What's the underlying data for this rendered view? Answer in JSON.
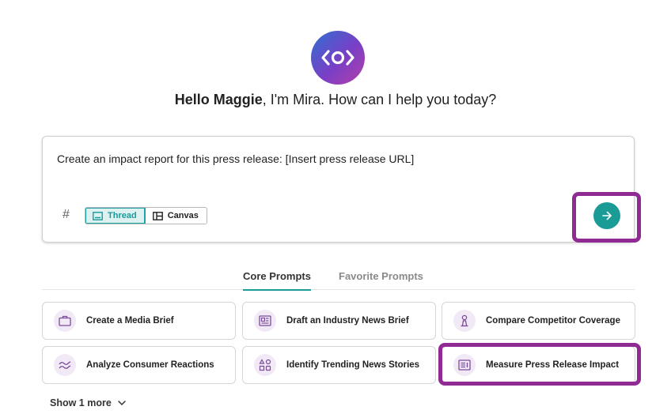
{
  "assistant": {
    "logo_icon": "mira-eye-icon",
    "greeting_name": "Hello Maggie",
    "greeting_rest": ", I'm Mira. How can I help you today?"
  },
  "composer": {
    "text": "Create an impact report for this press release: [Insert press release URL]",
    "hash_symbol": "#",
    "modes": [
      {
        "label": "Thread",
        "icon": "thread-icon",
        "active": true
      },
      {
        "label": "Canvas",
        "icon": "canvas-icon",
        "active": false
      }
    ],
    "send_icon": "arrow-right-icon"
  },
  "tabs": [
    {
      "label": "Core Prompts",
      "active": true
    },
    {
      "label": "Favorite Prompts",
      "active": false
    }
  ],
  "prompts": [
    {
      "label": "Create a Media Brief",
      "icon": "briefcase-icon"
    },
    {
      "label": "Draft an Industry News Brief",
      "icon": "newspaper-icon"
    },
    {
      "label": "Compare Competitor Coverage",
      "icon": "chess-pawn-icon"
    },
    {
      "label": "Analyze Consumer Reactions",
      "icon": "wave-lines-icon"
    },
    {
      "label": "Identify Trending News Stories",
      "icon": "shapes-icon"
    },
    {
      "label": "Measure Press Release Impact",
      "icon": "report-icon"
    }
  ],
  "show_more": {
    "label": "Show 1 more"
  },
  "colors": {
    "accent_teal": "#1b9b96",
    "highlight_purple": "#8f2b93",
    "icon_purple": "#7a4a9a"
  }
}
